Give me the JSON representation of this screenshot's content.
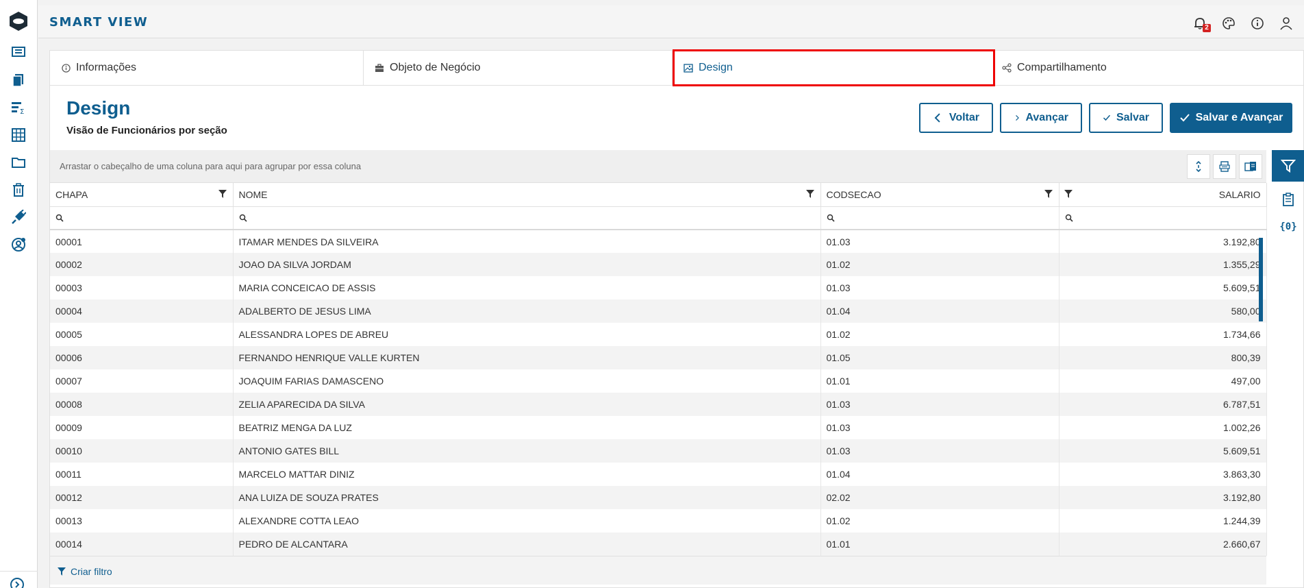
{
  "app": {
    "title": "SMART VIEW",
    "notification_count": "2"
  },
  "tabs": [
    {
      "label": "Informações",
      "icon": "info-icon"
    },
    {
      "label": "Objeto de Negócio",
      "icon": "briefcase-icon"
    },
    {
      "label": "Design",
      "icon": "image-icon",
      "active": true
    },
    {
      "label": "Compartilhamento",
      "icon": "share-icon"
    }
  ],
  "page": {
    "title": "Design",
    "subtitle": "Visão de Funcionários por seção"
  },
  "actions": {
    "back": "Voltar",
    "next": "Avançar",
    "save": "Salvar",
    "save_next": "Salvar e Avançar"
  },
  "grid": {
    "group_hint": "Arrastar o cabeçalho de uma coluna para aqui para agrupar por essa coluna",
    "columns": [
      "CHAPA",
      "NOME",
      "CODSECAO",
      "SALARIO"
    ],
    "rows": [
      [
        "00001",
        "ITAMAR MENDES DA SILVEIRA",
        "01.03",
        "3.192,80"
      ],
      [
        "00002",
        "JOAO DA SILVA JORDAM",
        "01.02",
        "1.355,29"
      ],
      [
        "00003",
        "MARIA CONCEICAO DE ASSIS",
        "01.03",
        "5.609,51"
      ],
      [
        "00004",
        "ADALBERTO DE JESUS LIMA",
        "01.04",
        "580,00"
      ],
      [
        "00005",
        "ALESSANDRA LOPES DE ABREU",
        "01.02",
        "1.734,66"
      ],
      [
        "00006",
        "FERNANDO HENRIQUE VALLE KURTEN",
        "01.05",
        "800,39"
      ],
      [
        "00007",
        "JOAQUIM FARIAS DAMASCENO",
        "01.01",
        "497,00"
      ],
      [
        "00008",
        "ZELIA APARECIDA DA SILVA",
        "01.03",
        "6.787,51"
      ],
      [
        "00009",
        "BEATRIZ MENGA DA LUZ",
        "01.03",
        "1.002,26"
      ],
      [
        "00010",
        "ANTONIO GATES BILL",
        "01.03",
        "5.609,51"
      ],
      [
        "00011",
        "MARCELO MATTAR DINIZ",
        "01.04",
        "3.863,30"
      ],
      [
        "00012",
        "ANA LUIZA DE SOUZA PRATES",
        "02.02",
        "3.192,80"
      ],
      [
        "00013",
        "ALEXANDRE COTTA LEAO",
        "01.02",
        "1.244,39"
      ],
      [
        "00014",
        "PEDRO DE ALCANTARA",
        "01.01",
        "2.660,67"
      ]
    ],
    "footer_link": "Criar filtro"
  },
  "side_panel": {
    "variables_label": "{0}"
  },
  "colors": {
    "primary": "#0f5e8f",
    "highlight": "#ee0000",
    "badge": "#d42323"
  }
}
